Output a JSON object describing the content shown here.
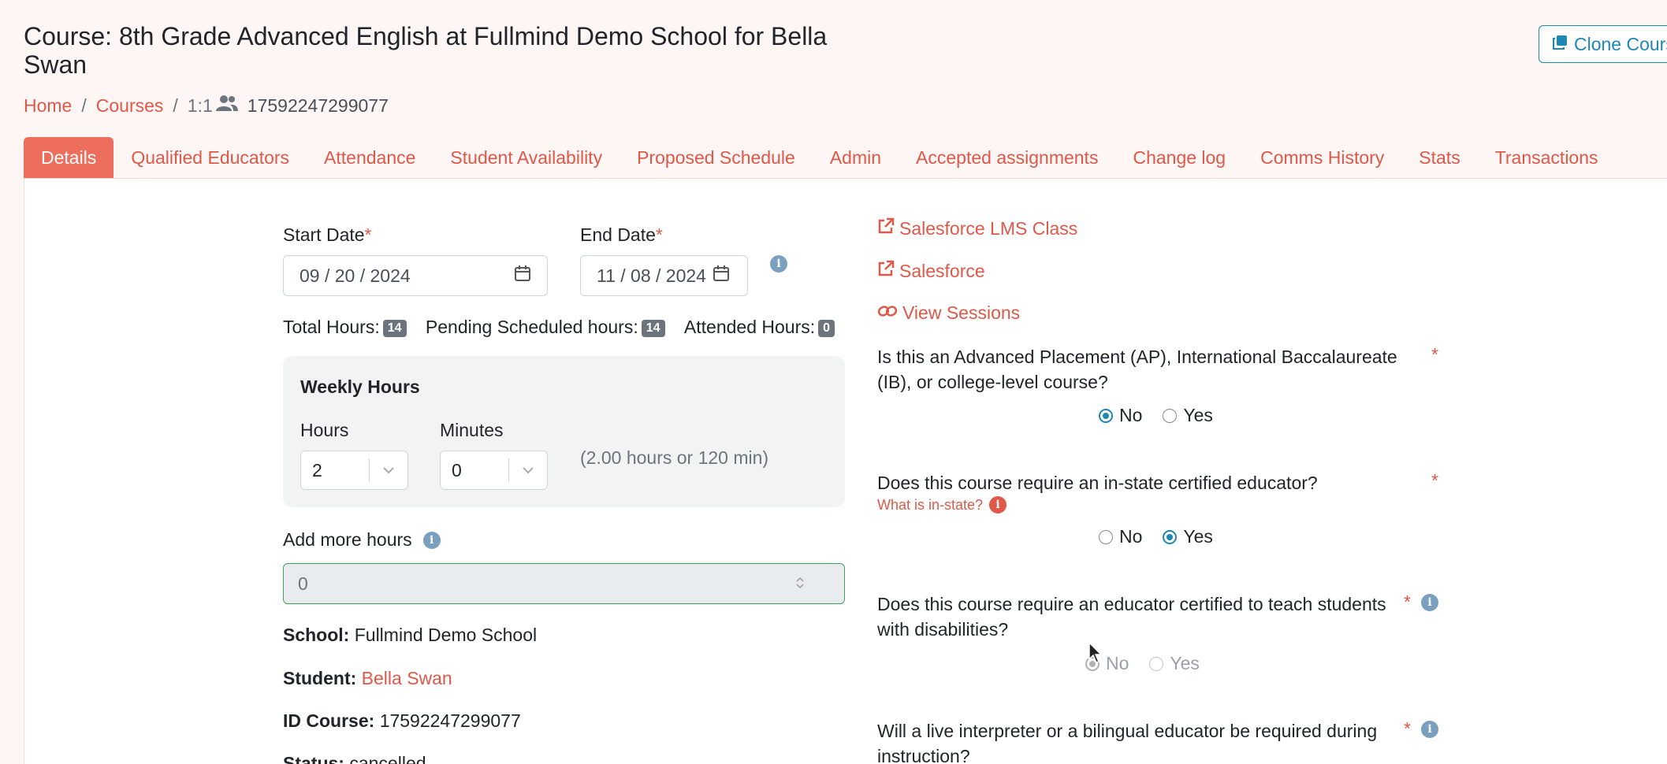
{
  "header": {
    "title": "Course: 8th Grade Advanced English at Fullmind Demo School for Bella Swan",
    "clone_label": "Clone Course"
  },
  "breadcrumb": {
    "home": "Home",
    "courses": "Courses",
    "type": "1:1",
    "course_id": "17592247299077",
    "sep": "/"
  },
  "tabs": [
    {
      "label": "Details",
      "active": true
    },
    {
      "label": "Qualified Educators"
    },
    {
      "label": "Attendance"
    },
    {
      "label": "Student Availability"
    },
    {
      "label": "Proposed Schedule"
    },
    {
      "label": "Admin"
    },
    {
      "label": "Accepted assignments"
    },
    {
      "label": "Change log"
    },
    {
      "label": "Comms History"
    },
    {
      "label": "Stats"
    },
    {
      "label": "Transactions"
    }
  ],
  "dates": {
    "start_label": "Start Date",
    "start_value": "09 / 20 / 2024",
    "end_label": "End Date",
    "end_value": "11 / 08 / 2024",
    "required": "*"
  },
  "hours": {
    "total_label": "Total Hours:",
    "total_value": "14",
    "pending_label": "Pending Scheduled hours:",
    "pending_value": "14",
    "attended_label": "Attended Hours:",
    "attended_value": "0"
  },
  "weekly": {
    "title": "Weekly Hours",
    "hours_label": "Hours",
    "hours_value": "2",
    "minutes_label": "Minutes",
    "minutes_value": "0",
    "summary": "(2.00 hours or 120 min)"
  },
  "more_hours": {
    "label": "Add more hours",
    "value": "0"
  },
  "details": {
    "school_label": "School:",
    "school_value": "Fullmind Demo School",
    "student_label": "Student:",
    "student_value": "Bella Swan",
    "id_label": "ID Course:",
    "id_value": "17592247299077",
    "status_label": "Status:",
    "status_value": "cancelled"
  },
  "links": {
    "lms": "Salesforce LMS Class",
    "salesforce": "Salesforce",
    "sessions": "View Sessions"
  },
  "questions": [
    {
      "text": "Is this an Advanced Placement (AP), International Baccalaureate (IB), or college-level course?",
      "selected": "No"
    },
    {
      "text": "Does this course require an in-state certified educator?",
      "sublink": "What is in-state?",
      "selected": "Yes"
    },
    {
      "text": "Does this course require an educator certified to teach students with disabilities?",
      "selected": "No",
      "disabled": true
    },
    {
      "text": "Will a live interpreter or a bilingual educator be required during instruction?"
    }
  ],
  "radio_labels": {
    "no": "No",
    "yes": "Yes"
  },
  "colors": {
    "accent": "#ee6e5e",
    "link": "#e05848",
    "primary": "#1e88b4",
    "success_border": "#3aa35b"
  }
}
